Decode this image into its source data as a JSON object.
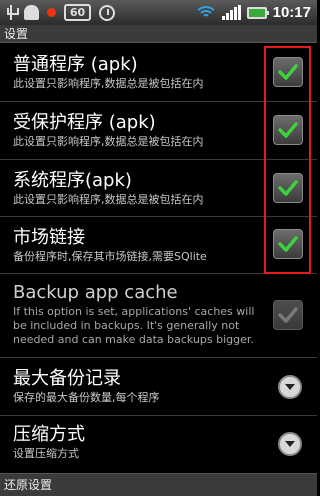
{
  "status_bar": {
    "time": "10:17",
    "badge": "60",
    "icons": [
      "usb-icon",
      "android-icon",
      "record-icon",
      "battery-saver-60-icon",
      "speed-icon",
      "wifi-icon",
      "signal-icon",
      "battery-charging-icon"
    ]
  },
  "screen_title": "设置",
  "items": [
    {
      "title": "普通程序 (apk)",
      "summary": "此设置只影响程序,数据总是被包括在内",
      "checked": true
    },
    {
      "title": "受保护程序 (apk)",
      "summary": "此设置只影响程序,数据总是被包括在内",
      "checked": true
    },
    {
      "title": "系统程序(apk)",
      "summary": "此设置只影响程序,数据总是被包括在内",
      "checked": true
    },
    {
      "title": "市场链接",
      "summary": "备份程序时,保存其市场链接,需要SQlite",
      "checked": true
    },
    {
      "title": "Backup app cache",
      "summary": "If this option is set, applications' caches will be included in backups. It's generally not needed and can make data backups bigger.",
      "checked": true,
      "enabled": false
    },
    {
      "title": "最大备份记录",
      "summary": "保存的最大备份数量,每个程序"
    },
    {
      "title": "压缩方式",
      "summary": "设置压缩方式"
    }
  ],
  "footer_title": "还原设置",
  "colors": {
    "check": "#3dd13d",
    "highlight_box": "#e01c1c"
  }
}
